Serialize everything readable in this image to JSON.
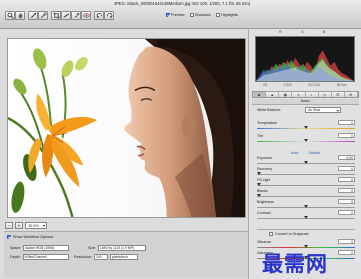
{
  "window": {
    "title": "JPEG: iStock_000001544138Medium.jpg  ISO 100, 1/200, 7.1 f/8, 85 mm)"
  },
  "toolbar": {
    "tools": [
      "zoom-icon",
      "hand-icon",
      "eyedropper-icon",
      "color-sampler-icon",
      "crop-icon",
      "straighten-icon",
      "retouch-icon",
      "red-eye-icon",
      "rotate-left-icon",
      "rotate-right-icon"
    ],
    "preview_label": "Preview",
    "shadows_label": "Shadows",
    "highlights_label": "Highlights",
    "preview_checked": true,
    "shadows_checked": false,
    "highlights_checked": false
  },
  "histogram": {
    "r": "R:",
    "g": "G:",
    "b": "B:",
    "exif": [
      "f/8",
      "1/200",
      "ISO 100",
      "85 mm"
    ]
  },
  "panel": {
    "tabs": [
      "◉",
      "▲",
      "▦",
      "≡",
      "◐",
      "◎",
      "☰",
      "⊞"
    ],
    "section_title": "Basic",
    "white_balance_label": "White Balance:",
    "white_balance_value": "As Shot",
    "auto_label": "Auto",
    "default_label": "Default",
    "sliders": [
      {
        "label": "Temperature",
        "value": "0",
        "pos": 0.5
      },
      {
        "label": "Tint",
        "value": "0",
        "pos": 0.5
      },
      {
        "label": "Exposure",
        "value": "0.00",
        "pos": 0.5
      },
      {
        "label": "Recovery",
        "value": "0",
        "pos": 0.02
      },
      {
        "label": "Fill Light",
        "value": "0",
        "pos": 0.02
      },
      {
        "label": "Blacks",
        "value": "0",
        "pos": 0.02
      },
      {
        "label": "Brightness",
        "value": "0",
        "pos": 0.5
      },
      {
        "label": "Contrast",
        "value": "0",
        "pos": 0.5
      },
      {
        "label": "Vibrance",
        "value": "0",
        "pos": 0.5
      },
      {
        "label": "Saturation",
        "value": "0",
        "pos": 0.5
      }
    ],
    "grayscale_label": "Convert to Grayscale",
    "grayscale_checked": false
  },
  "zoom": {
    "minus": "−",
    "plus": "+",
    "value": "30.9%"
  },
  "workflow": {
    "title": "Show Workflow Options",
    "space_label": "Space:",
    "space_value": "Adobe RGB (1998)",
    "depth_label": "Depth:",
    "depth_value": "8 Bits/Channel",
    "size_label": "Size:",
    "size_value": "1690 by 1115 (1.9 MP)",
    "resolution_label": "Resolution:",
    "resolution_value": "240",
    "resolution_unit": "pixels/inch"
  },
  "watermark": "最需网"
}
